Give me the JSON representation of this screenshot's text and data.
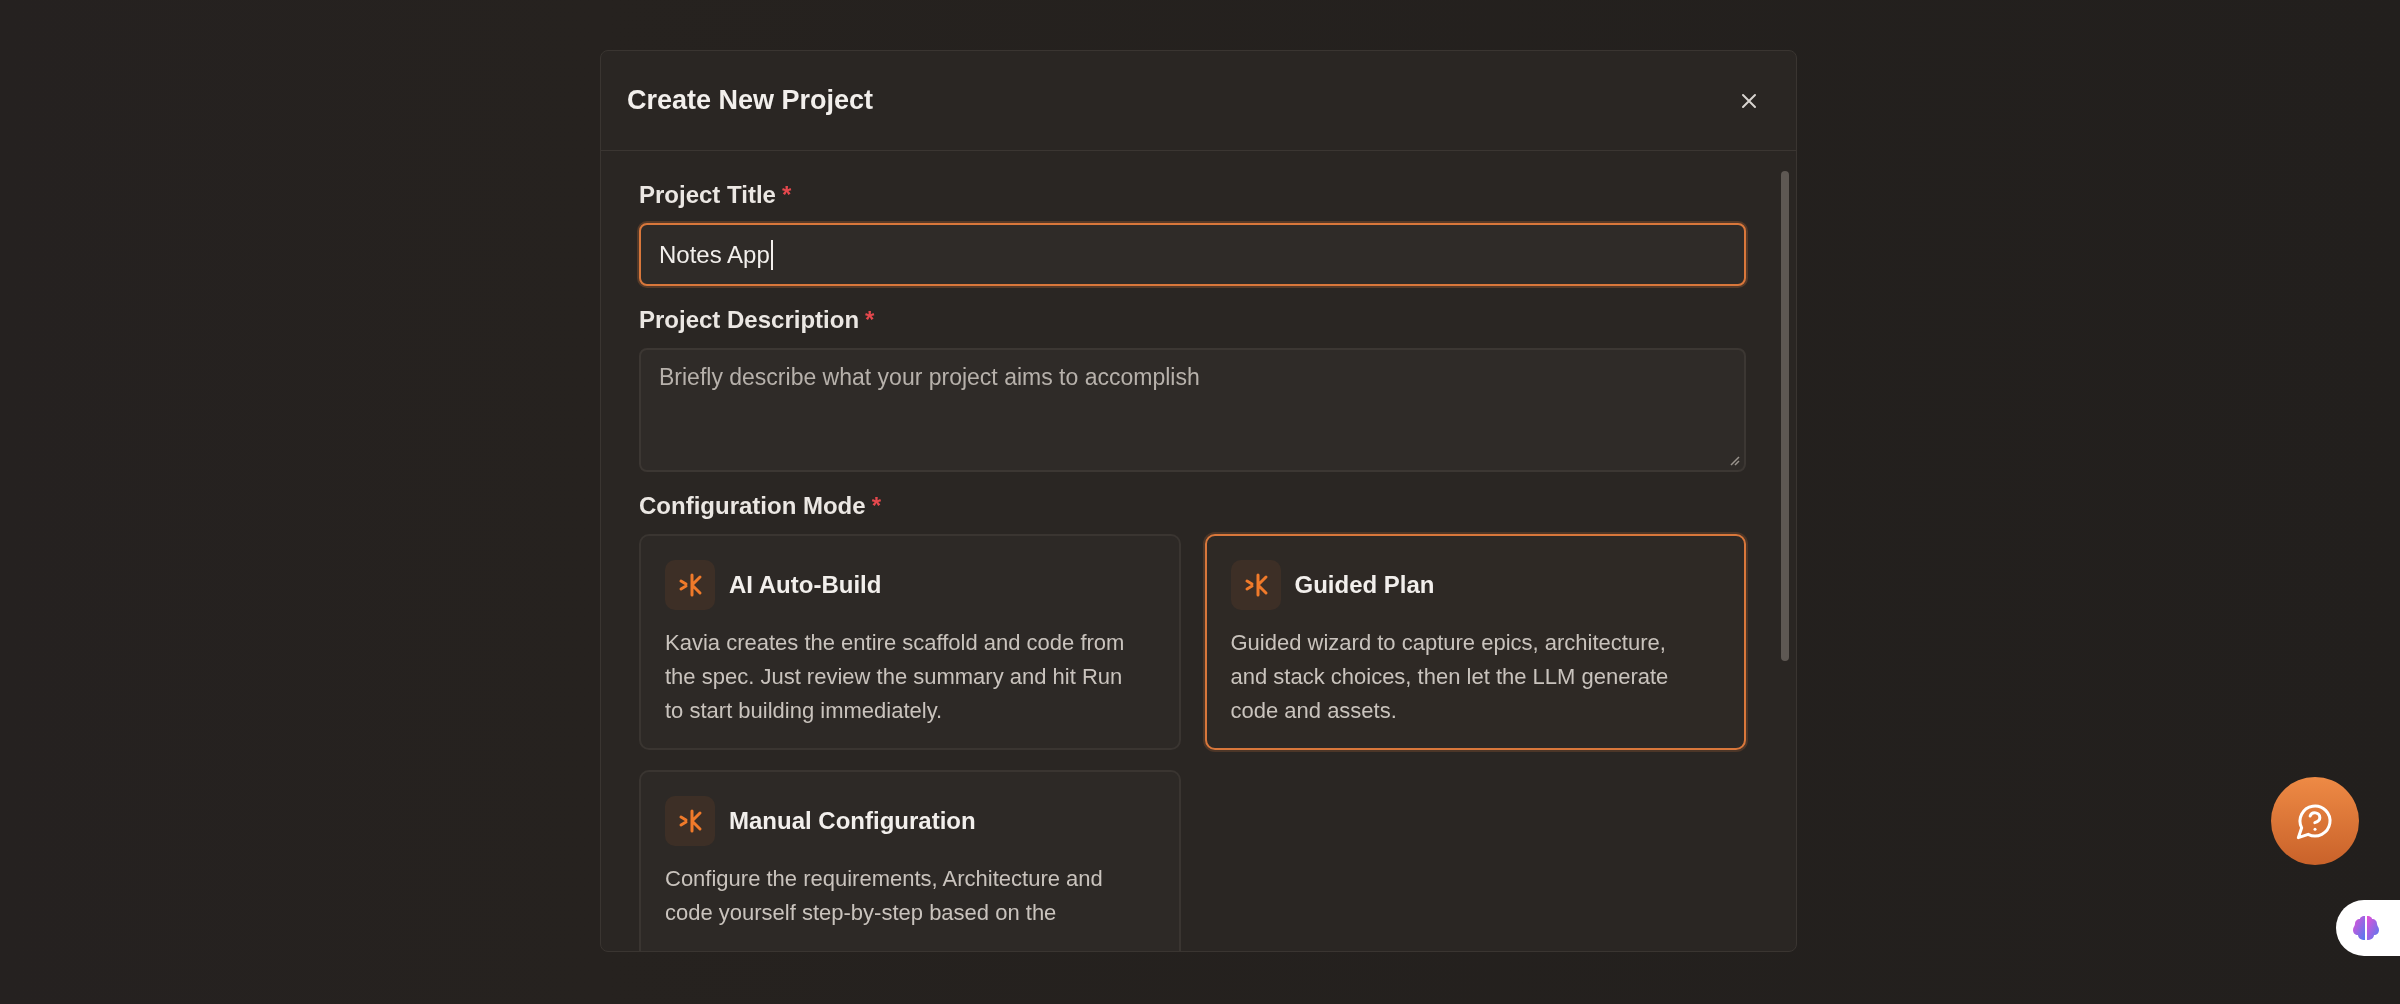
{
  "dialog": {
    "title": "Create New Project"
  },
  "fields": [
    {
      "kind": "input",
      "label": "Project Title",
      "required_mark": "*",
      "value": "Notes App",
      "focused": true
    },
    {
      "kind": "textarea",
      "label": "Project Description",
      "required_mark": "*",
      "placeholder": "Briefly describe what your project aims to accomplish",
      "focused": false
    }
  ],
  "configuration": {
    "label": "Configuration Mode",
    "required_mark": "*",
    "modes": [
      {
        "title": "AI Auto-Build",
        "description": "Kavia creates the entire scaffold and code from the spec. Just review the summary and hit Run to start building immediately.",
        "selected": false
      },
      {
        "title": "Guided Plan",
        "description": "Guided wizard to capture epics, architecture, and stack choices, then let the LLM generate code and assets.",
        "selected": true
      },
      {
        "title": "Manual Configuration",
        "description": "Configure the requirements, Architecture and code yourself step-by-step based on the",
        "selected": false
      }
    ]
  }
}
